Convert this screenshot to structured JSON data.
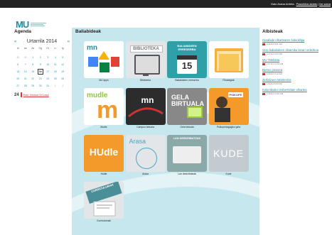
{
  "topbar": {
    "user": "Galo Arana Arrieta",
    "link1": "Pasahitza aldatu",
    "sep": "|",
    "link2": "Itxi saioa"
  },
  "agenda": {
    "title": "Agenda",
    "month_label": "Urtarrila 2014",
    "prev_arrow": "«",
    "next_arrow": "»",
    "weekdays": [
      "Al",
      "As",
      "Az",
      "Og",
      "Or",
      "Lr",
      "Ig"
    ],
    "days": [
      {
        "d": "30",
        "m": "other"
      },
      {
        "d": "31",
        "m": "other"
      },
      {
        "d": "1",
        "m": ""
      },
      {
        "d": "2",
        "m": ""
      },
      {
        "d": "3",
        "m": ""
      },
      {
        "d": "4",
        "m": ""
      },
      {
        "d": "5",
        "m": ""
      },
      {
        "d": "6",
        "m": ""
      },
      {
        "d": "7",
        "m": ""
      },
      {
        "d": "8",
        "m": ""
      },
      {
        "d": "9",
        "m": ""
      },
      {
        "d": "10",
        "m": ""
      },
      {
        "d": "11",
        "m": ""
      },
      {
        "d": "12",
        "m": ""
      },
      {
        "d": "13",
        "m": ""
      },
      {
        "d": "14",
        "m": ""
      },
      {
        "d": "15",
        "m": ""
      },
      {
        "d": "16",
        "m": "today"
      },
      {
        "d": "17",
        "m": ""
      },
      {
        "d": "18",
        "m": ""
      },
      {
        "d": "19",
        "m": ""
      },
      {
        "d": "20",
        "m": ""
      },
      {
        "d": "21",
        "m": ""
      },
      {
        "d": "22",
        "m": ""
      },
      {
        "d": "23",
        "m": ""
      },
      {
        "d": "24",
        "m": ""
      },
      {
        "d": "25",
        "m": ""
      },
      {
        "d": "26",
        "m": ""
      },
      {
        "d": "27",
        "m": ""
      },
      {
        "d": "28",
        "m": ""
      },
      {
        "d": "29",
        "m": ""
      },
      {
        "d": "30",
        "m": ""
      },
      {
        "d": "31",
        "m": ""
      },
      {
        "d": "1",
        "m": "other"
      },
      {
        "d": "2",
        "m": "other"
      }
    ],
    "event": {
      "day": "24",
      "label": "Eskr Ireland Sr Lacy"
    }
  },
  "main": {
    "title": "Baliabideak",
    "tiles": [
      {
        "caption": "MU apps",
        "name": "tile-mu-apps"
      },
      {
        "caption": "Biblioteka",
        "name": "tile-biblioteka",
        "label": "BIBLIOTEKA"
      },
      {
        "caption": "Baliabideen erreserba",
        "name": "tile-baliabideen-erreserba",
        "label": "BALIABIDEEN ERRESERBA",
        "num": "15"
      },
      {
        "caption": "Fitxategiak",
        "name": "tile-fitxategiak"
      },
      {
        "caption": "Mudle",
        "name": "tile-mudle",
        "label": "mudle"
      },
      {
        "caption": "Campus birtuala",
        "name": "tile-campus-birtuala"
      },
      {
        "caption": "Gela birtuala",
        "name": "tile-gela-birtuala",
        "label": "GELA BIRTUALA"
      },
      {
        "caption": "Psikopedagogiko gela",
        "name": "tile-psikopedagogiko-gela",
        "label": "PSIKOPE"
      },
      {
        "caption": "Hudle",
        "name": "tile-hudle",
        "label": "HUdle"
      },
      {
        "caption": "Arasa",
        "name": "tile-arasa",
        "label": "Arasa"
      },
      {
        "caption": "Lan deskribatzak",
        "name": "tile-lan-deskribatzak",
        "label": "LAN DESKRIBATZAK"
      },
      {
        "caption": "Kude",
        "name": "tile-kude",
        "label": "KUDE"
      },
      {
        "caption": "Curriculumak",
        "name": "tile-curriculumak",
        "label": "CURRICULUMAK"
      }
    ]
  },
  "albisteak": {
    "title": "Albisteak",
    "items": [
      {
        "title": "Garabide elkartearen bideoklipa",
        "date": "1/20/14 8:01 AM"
      },
      {
        "title": "Giza baliabideen dinamika lanari ordezkoa",
        "date": "1/17/14 3:47 PM"
      },
      {
        "title": "MU Telebista",
        "date": "1/17/14 11:52 AM"
      },
      {
        "title": "Berteo pinaxea",
        "date": "1/16/14 9:12 AM"
      },
      {
        "title": "Zerbitzuen Mantentza",
        "date": "1/16/14 8:43 AM"
      },
      {
        "title": "Kolombiako Unibertsitate elkartea",
        "date": "1/15/14 11:20 AM"
      }
    ]
  },
  "colors": {
    "accent": "#1a8fa6",
    "panel_bg": "#c6e7ee",
    "topbar_bg": "#222222",
    "event_red": "#dd3333"
  },
  "logo": {
    "text": "MU"
  }
}
